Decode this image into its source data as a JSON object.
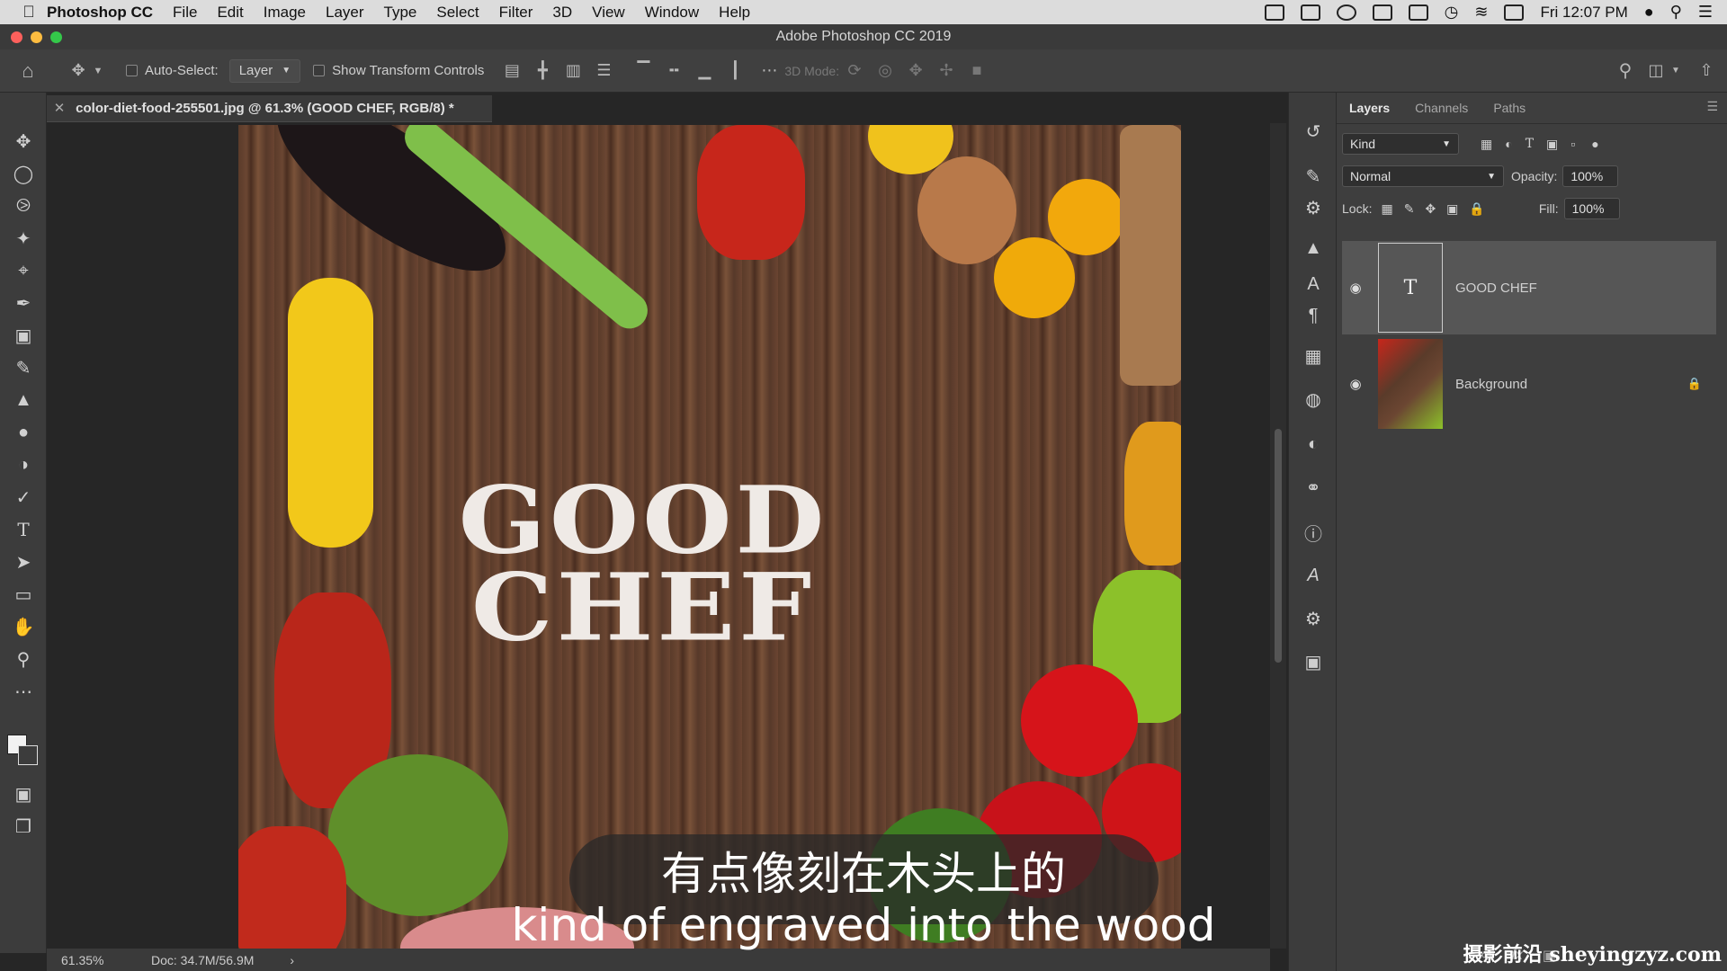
{
  "menubar": {
    "app_name": "Photoshop CC",
    "menus": [
      "File",
      "Edit",
      "Image",
      "Layer",
      "Type",
      "Select",
      "Filter",
      "3D",
      "View",
      "Window",
      "Help"
    ],
    "clock": "Fri 12:07 PM"
  },
  "window": {
    "title": "Adobe Photoshop CC 2019"
  },
  "options_bar": {
    "auto_select_label": "Auto-Select:",
    "auto_select_target": "Layer",
    "show_transform_label": "Show Transform Controls",
    "mode_3d_label": "3D Mode:"
  },
  "document": {
    "tab_label": "color-diet-food-255501.jpg @ 61.3% (GOOD CHEF, RGB/8) *",
    "headline_line1": "GOOD",
    "headline_line2": "CHEF"
  },
  "status_bar": {
    "zoom": "61.35%",
    "doc_size": "Doc: 34.7M/56.9M"
  },
  "layers_panel": {
    "tabs": [
      "Layers",
      "Channels",
      "Paths"
    ],
    "filter_kind": "Kind",
    "blend_mode": "Normal",
    "opacity_label": "Opacity:",
    "opacity_value": "100%",
    "lock_label": "Lock:",
    "fill_label": "Fill:",
    "fill_value": "100%",
    "layers": [
      {
        "name": "GOOD CHEF",
        "type": "text",
        "thumb_glyph": "T",
        "visible": true,
        "selected": true
      },
      {
        "name": "Background",
        "type": "image",
        "visible": true,
        "locked": true
      }
    ]
  },
  "subtitles": {
    "chinese": "有点像刻在木头上的",
    "english": "kind of engraved into the wood"
  },
  "watermark": "摄影前沿 sheyingzyz.com",
  "colors": {
    "menubar_bg": "#dcdcdc",
    "panel_bg": "#3e3e3e",
    "headline": "#efeae6"
  }
}
